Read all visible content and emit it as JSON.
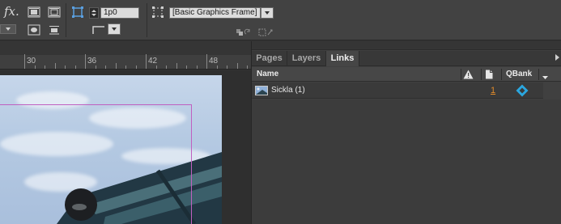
{
  "control_bar": {
    "fx_label": "fx.",
    "stroke_weight_value": "1p0",
    "object_style_value": "[Basic Graphics Frame]"
  },
  "ruler": {
    "labels": [
      "30",
      "36",
      "42",
      "48"
    ]
  },
  "panel": {
    "tabs": [
      {
        "label": "Pages",
        "active": false
      },
      {
        "label": "Layers",
        "active": false
      },
      {
        "label": "Links",
        "active": true
      }
    ],
    "columns": {
      "name": "Name",
      "qbank": "QBank"
    },
    "links": [
      {
        "name": "Sickla (1)",
        "page": "1",
        "page_color": "#e08a2a",
        "qbank_icon": "qbank-diamond-icon",
        "qbank_color": "#2aa7e0"
      }
    ]
  },
  "colors": {
    "frame_edge": "#c060c0",
    "link_page_number": "#e08a2a",
    "qbank_brand": "#2aa7e0"
  }
}
